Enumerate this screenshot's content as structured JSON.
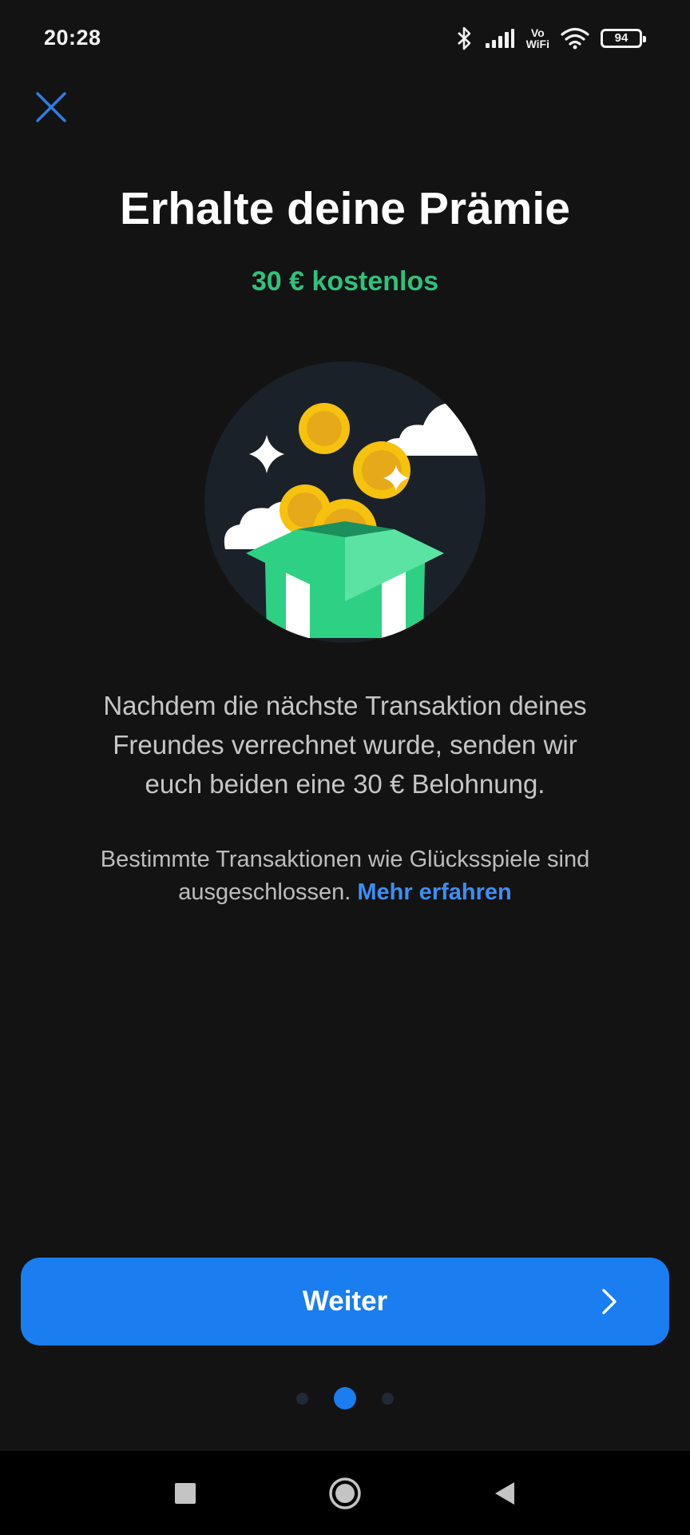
{
  "status_bar": {
    "time": "20:28",
    "vowifi_top": "Vo",
    "vowifi_bottom": "WiFi",
    "battery": "94",
    "icons": [
      "bluetooth-icon",
      "signal-icon",
      "vowifi-icon",
      "wifi-icon",
      "battery-icon"
    ]
  },
  "header": {
    "close_icon": "close-icon"
  },
  "main": {
    "title": "Erhalte deine Prämie",
    "subtitle": "30 € kostenlos",
    "illustration": "gift-box-with-coins",
    "body_line_1": "Nachdem die nächste Transaktion deines",
    "body_line_2": "Freundes verrechnet wurde, senden wir",
    "body_line_3": "euch beiden eine 30 € Belohnung.",
    "note_line_1": "Bestimmte Transaktionen wie Glücksspiele sind",
    "note_line_2": "ausgeschlossen.",
    "note_link": "Mehr erfahren"
  },
  "footer": {
    "continue_label": "Weiter",
    "continue_icon": "chevron-right-icon",
    "pager": {
      "total": 3,
      "active_index": 1
    }
  },
  "nav_bar": {
    "icons": [
      "recents-icon",
      "home-icon",
      "back-icon"
    ]
  },
  "colors": {
    "background": "#131313",
    "accent_green": "#2fc27c",
    "accent_blue": "#1a7df0",
    "link_blue": "#3d8ef5",
    "close_blue": "#2f7ee8"
  }
}
